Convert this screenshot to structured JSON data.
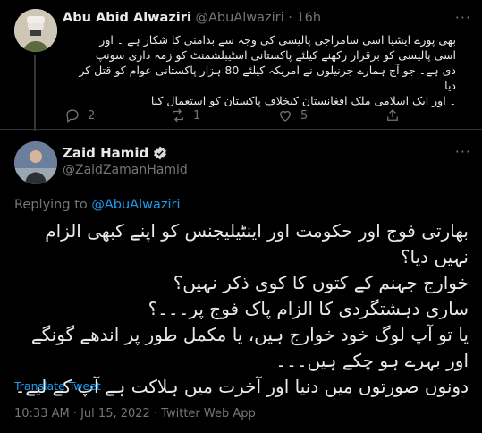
{
  "reply_tweet": {
    "author_name": "Abu Abid Alwaziri",
    "handle": "@AbuAlwaziri",
    "separator": "·",
    "time": "16h",
    "lines": [
      "بھی پورے ایشیا اسی سامراجی پالیسی کی وجہ سے بدامنی کا شکار ہے ۔ اور",
      "اسی پالیسی کو برقرار رکھنے کیلئے پاکستانی اسٹیبلشمنٹ کو زمہ داری سونپ",
      "دی ہے۔ جو آج ہمارے جرنیلوں نے امریکہ کیلئے 80 ہزار پاکستانی عوام کو قتل کر دیا",
      "۔ اور ایک اسلامی ملک افغانستان کیخلاف پاکستان کو استعمال کیا"
    ],
    "reply_count": "2",
    "retweet_count": "1",
    "like_count": "5"
  },
  "main_tweet": {
    "author_name": "Zaid Hamid",
    "handle": "@ZaidZamanHamid",
    "replying_prefix": "Replying to ",
    "replying_to": "@AbuAlwaziri",
    "lines": [
      "بھارتی فوج اور حکومت اور اینٹیلیجنس کو اپنے کبھی الزام",
      "نہیں دیا؟",
      "خوارج جہنم کے کتوں کا کوی ذکر نہیں؟",
      "ساری دہشتگردی کا الزام پاک فوج پر۔۔۔؟",
      "یا تو آپ لوگ خود خوارج ہیں، یا مکمل طور پر اندھے گونگے",
      "اور بہرے ہو چکے ہیں۔۔۔",
      "دونوں صورتوں میں دنیا اور آخرت میں ہلاکت ہے آپ کے لیے۔"
    ],
    "translate_label": "Translate Tweet",
    "timestamp": "10:33 AM · Jul 15, 2022 · Twitter Web App"
  },
  "colors": {
    "background": "#000000",
    "text": "#e7e9ea",
    "muted": "#71767b",
    "accent": "#1d9bf0",
    "divider": "#2f3336"
  },
  "icons": [
    "reply-icon",
    "retweet-icon",
    "like-icon",
    "share-icon",
    "more-icon",
    "verified-icon"
  ]
}
